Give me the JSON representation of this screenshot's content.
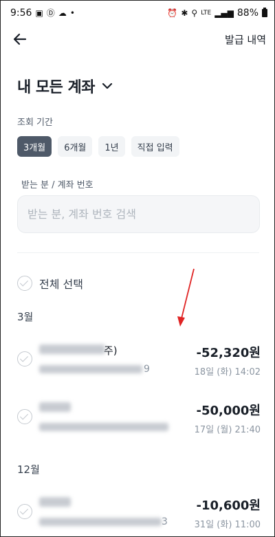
{
  "status_bar": {
    "time": "9:56",
    "network": "LTE",
    "battery": "88%"
  },
  "header": {
    "issue_history": "발급 내역"
  },
  "account_selector": {
    "title": "내 모든 계좌"
  },
  "period": {
    "label": "조회 기간",
    "options": [
      "3개월",
      "6개월",
      "1년",
      "직접 입력"
    ],
    "selected": "3개월"
  },
  "search": {
    "label": "받는 분 / 계좌 번호",
    "placeholder": "받는 분, 계좌 번호 검색"
  },
  "select_all": {
    "label": "전체 선택"
  },
  "groups": [
    {
      "month": "3월",
      "items": [
        {
          "name_tail": "주)",
          "account_tail": "9",
          "amount": "-52,320원",
          "datetime": "18일 (화) 14:02"
        },
        {
          "name_tail": "",
          "account_tail": "",
          "amount": "-50,000원",
          "datetime": "17일 (월) 21:40"
        }
      ]
    },
    {
      "month": "12월",
      "items": [
        {
          "name_tail": "",
          "account_tail": "3",
          "amount": "-10,600원",
          "datetime": "31일 (화) 11:00"
        }
      ]
    }
  ],
  "colors": {
    "active_chip": "#4e5968",
    "annotation_arrow": "#e02424"
  }
}
